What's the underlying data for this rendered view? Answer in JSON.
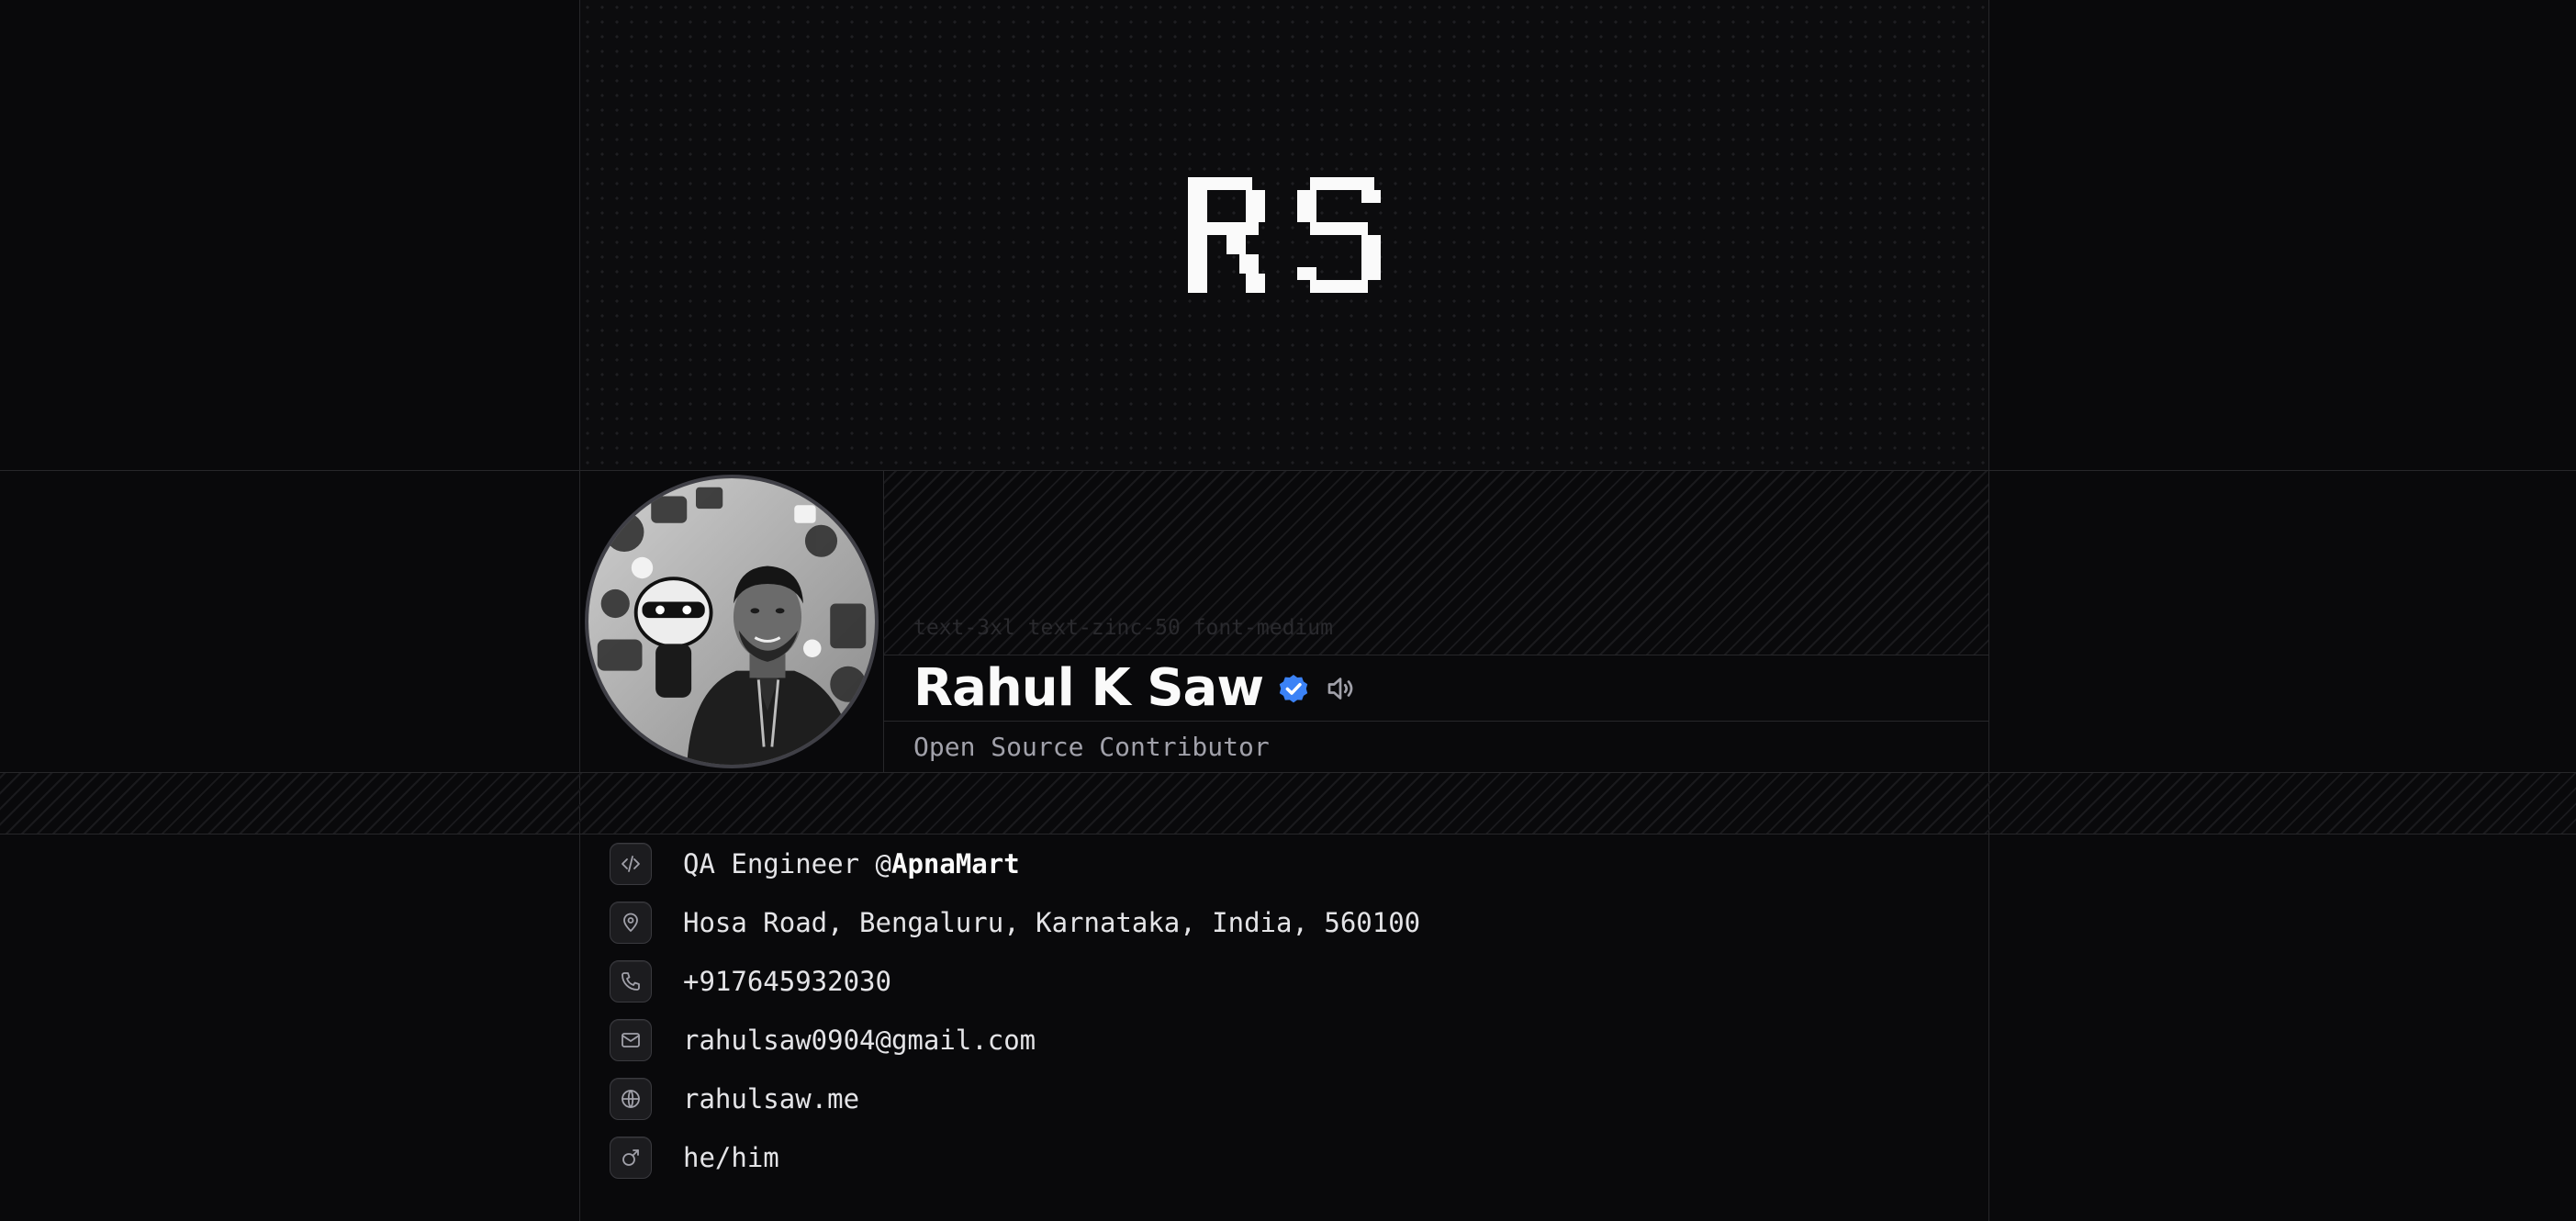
{
  "header": {
    "monogram": "RS"
  },
  "profile": {
    "class_hint": "text-3xl text-zinc-50 font-medium",
    "name": "Rahul K Saw",
    "tagline": "Open Source Contributor",
    "verified_color": "#3b82f6"
  },
  "info": {
    "job_title": "QA Engineer @",
    "company": "ApnaMart",
    "address": "Hosa Road, Bengaluru, Karnataka, India, 560100",
    "phone": "+917645932030",
    "email": "rahulsaw0904@gmail.com",
    "website": "rahulsaw.me",
    "pronouns": "he/him"
  },
  "icons": {
    "job": "code-icon",
    "address": "map-pin-icon",
    "phone": "phone-icon",
    "email": "mail-icon",
    "website": "globe-icon",
    "pronouns": "male-icon",
    "verified": "verified-badge-icon",
    "pronounce": "speaker-icon"
  },
  "colors": {
    "background": "#09090b",
    "border": "#27272a",
    "text": "#fafafa",
    "muted": "#a1a1aa",
    "accent": "#3b82f6"
  }
}
